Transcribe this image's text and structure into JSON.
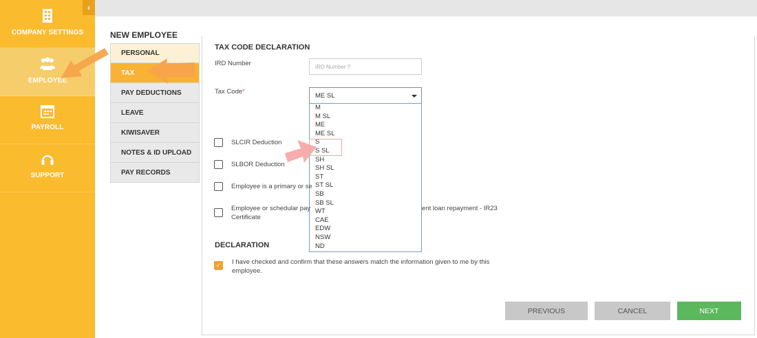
{
  "sidebar": {
    "collapse_glyph": "‹",
    "items": [
      {
        "label": "COMPANY SETTINGS",
        "icon": "building-icon"
      },
      {
        "label": "EMPLOYEE",
        "icon": "users-icon"
      },
      {
        "label": "PAYROLL",
        "icon": "calendar-icon"
      },
      {
        "label": "SUPPORT",
        "icon": "headset-icon"
      }
    ]
  },
  "page_title": "NEW EMPLOYEE",
  "nav": [
    "PERSONAL",
    "TAX",
    "PAY DEDUCTIONS",
    "LEAVE",
    "KIWISAVER",
    "NOTES & ID UPLOAD",
    "PAY RECORDS"
  ],
  "form": {
    "section_title": "TAX CODE DECLARATION",
    "ird_label": "IRD Number",
    "ird_placeholder": "IRD Number ?",
    "tax_code_label": "Tax Code",
    "tax_code_required": "*",
    "tax_code_value": "ME SL",
    "tax_code_options": [
      "M",
      "M SL",
      "ME",
      "ME SL",
      "S",
      "S SL",
      "SH",
      "SH SL",
      "ST",
      "ST SL",
      "SB",
      "SB SL",
      "WT",
      "CAE",
      "EDW",
      "NSW",
      "ND"
    ],
    "checkboxes": [
      {
        "label": "SLCIR Deduction",
        "checked": false
      },
      {
        "label": "SLBOR Deduction",
        "checked": false
      },
      {
        "label": "Employee is a primary or se",
        "checked": false
      },
      {
        "label_line1": "Employee or schedular pay",
        "label_line1_tail": "ent loan repayment - IR23",
        "label_line2": "Certificate",
        "checked": false
      }
    ],
    "declaration_title": "DECLARATION",
    "declaration_line1": "I have checked and confirm that these answers match the information given to me by this",
    "declaration_line2": "employee.",
    "declaration_checked": true
  },
  "buttons": {
    "previous": "PREVIOUS",
    "cancel": "CANCEL",
    "next": "NEXT"
  },
  "colors": {
    "sidebar": "#fbbb2e",
    "active_tab": "#f9b233",
    "next_button": "#5cb85c",
    "annotation_arrow": "#f7a44a"
  }
}
